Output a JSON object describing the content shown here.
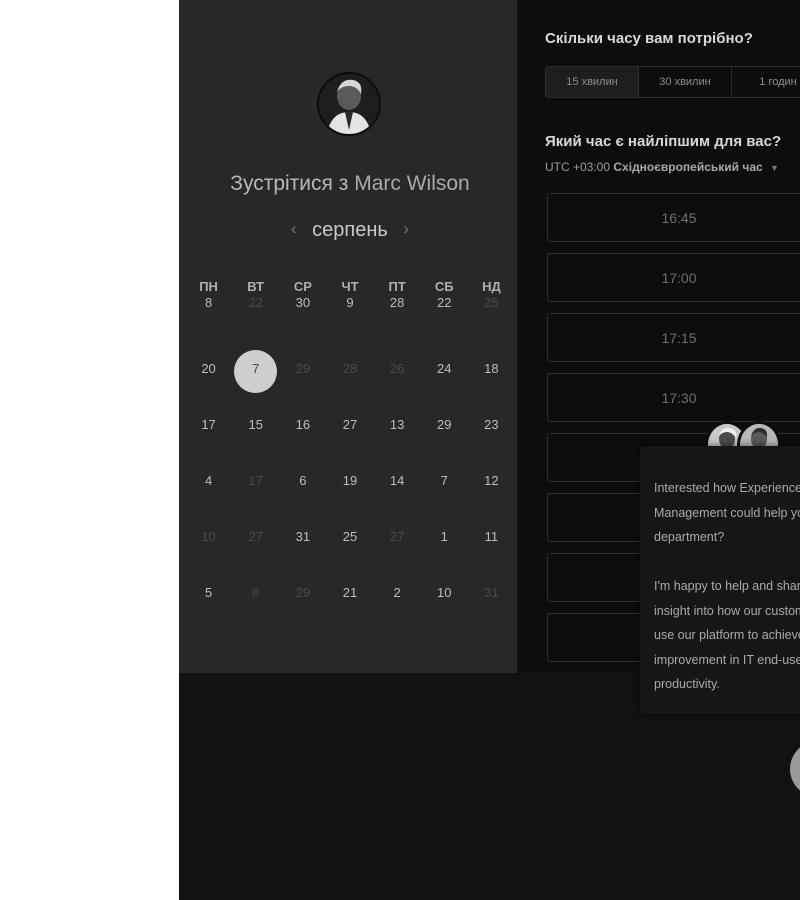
{
  "scheduler": {
    "title_prefix": "Зустрітися з",
    "host_name": "Marc Wilson",
    "month": "серпень",
    "prev_icon": "chevron-left-icon",
    "next_icon": "chevron-right-icon",
    "weekdays": [
      "ПН",
      "ВТ",
      "СР",
      "ЧТ",
      "ПТ",
      "СБ",
      "НД"
    ],
    "weeks": [
      [
        {
          "n": "8",
          "s": "normal"
        },
        {
          "n": "22",
          "s": "dim"
        },
        {
          "n": "30",
          "s": "normal"
        },
        {
          "n": "9",
          "s": "normal"
        },
        {
          "n": "28",
          "s": "normal"
        },
        {
          "n": "22",
          "s": "normal"
        },
        {
          "n": "25",
          "s": "dim"
        }
      ],
      [
        {
          "n": "20",
          "s": "normal"
        },
        {
          "n": "7",
          "s": "selected"
        },
        {
          "n": "29",
          "s": "dim"
        },
        {
          "n": "28",
          "s": "dim"
        },
        {
          "n": "26",
          "s": "dim"
        },
        {
          "n": "24",
          "s": "normal"
        },
        {
          "n": "18",
          "s": "normal"
        }
      ],
      [
        {
          "n": "17",
          "s": "normal"
        },
        {
          "n": "15",
          "s": "normal"
        },
        {
          "n": "16",
          "s": "normal"
        },
        {
          "n": "27",
          "s": "normal"
        },
        {
          "n": "13",
          "s": "normal"
        },
        {
          "n": "29",
          "s": "normal"
        },
        {
          "n": "23",
          "s": "normal"
        }
      ],
      [
        {
          "n": "4",
          "s": "normal"
        },
        {
          "n": "17",
          "s": "dim"
        },
        {
          "n": "6",
          "s": "normal"
        },
        {
          "n": "19",
          "s": "normal"
        },
        {
          "n": "14",
          "s": "normal"
        },
        {
          "n": "7",
          "s": "normal"
        },
        {
          "n": "12",
          "s": "normal"
        }
      ],
      [
        {
          "n": "10",
          "s": "dim"
        },
        {
          "n": "27",
          "s": "dim"
        },
        {
          "n": "31",
          "s": "normal"
        },
        {
          "n": "25",
          "s": "normal"
        },
        {
          "n": "27",
          "s": "dim"
        },
        {
          "n": "1",
          "s": "normal"
        },
        {
          "n": "11",
          "s": "normal"
        }
      ],
      [
        {
          "n": "5",
          "s": "normal"
        },
        {
          "n": "8",
          "s": "dim"
        },
        {
          "n": "29",
          "s": "dim"
        },
        {
          "n": "21",
          "s": "normal"
        },
        {
          "n": "2",
          "s": "normal"
        },
        {
          "n": "10",
          "s": "normal"
        },
        {
          "n": "31",
          "s": "dim"
        }
      ]
    ]
  },
  "booking": {
    "duration_question": "Скільки часу вам потрібно?",
    "durations": [
      "15 хвилин",
      "30 хвилин",
      "1 годин"
    ],
    "time_question": "Який час є найліпшим для вас?",
    "timezone_offset": "UTC +03:00",
    "timezone_name": "Східноєвропейський час",
    "timezone_caret": "▼",
    "slots": [
      "16:45",
      "17:00",
      "17:15",
      "17:30",
      "",
      "",
      "",
      ""
    ]
  },
  "chat": {
    "lines": [
      "Interested how Experience",
      "Management could help your",
      "department?",
      "",
      "I'm happy to help and share",
      "insight into how our customers",
      "use our platform to achieve",
      "improvement in IT end-user",
      "productivity."
    ]
  },
  "colors": {
    "page": "#ffffff",
    "stage": "#121212",
    "left_panel": "#282828",
    "right_panel": "#0d0d0d",
    "selected_day": "#cfcfcf"
  }
}
